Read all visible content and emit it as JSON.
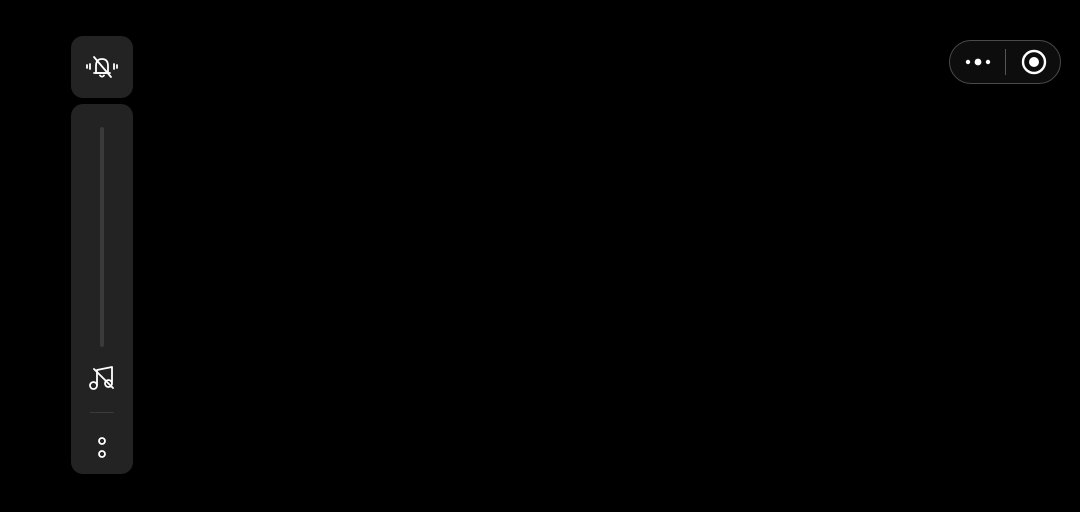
{
  "volume_panel": {
    "ringer_mode": "silent",
    "ringer_icon": "bell-off-icon",
    "stream_icon": "music-note-off-icon",
    "media_volume_level": 0,
    "expand_icon": "more-vertical-icon"
  },
  "capsule_menu": {
    "more_icon": "more-horizontal-icon",
    "close_icon": "record-circle-icon"
  },
  "colors": {
    "background": "#000000",
    "panel": "#232323",
    "icon": "#ffffff",
    "track": "#3a3a3a",
    "capsule_border": "#4a4a4a"
  }
}
